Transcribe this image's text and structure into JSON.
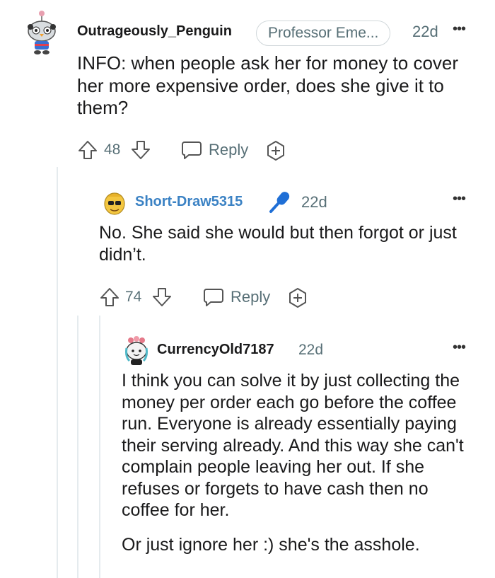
{
  "comments": [
    {
      "username": "Outrageously_Penguin",
      "flair": "Professor Eme...",
      "age": "22d",
      "more": "•••",
      "body": [
        "INFO: when people ask her for money to cover her more expensive order, does she give it to them?"
      ],
      "votes": "48",
      "reply_label": "Reply"
    },
    {
      "username": "Short-Draw5315",
      "age": "22d",
      "more": "•••",
      "body": [
        "No. She said she would but then forgot or just didn’t."
      ],
      "votes": "74",
      "reply_label": "Reply"
    },
    {
      "username": "CurrencyOld7187",
      "age": "22d",
      "more": "•••",
      "body": [
        "I think you can solve it by just collecting the money per order each go before the coffee run. Everyone is already essentially paying their serving already. And this way she can't complain people leaving her out. If she refuses or forgets to have cash then no coffee for her.",
        "Or just ignore her :) she's the asshole."
      ]
    }
  ],
  "colors": {
    "username_link": "#3b82c4",
    "mic": "#1f6fd6",
    "meta": "#576f76"
  }
}
